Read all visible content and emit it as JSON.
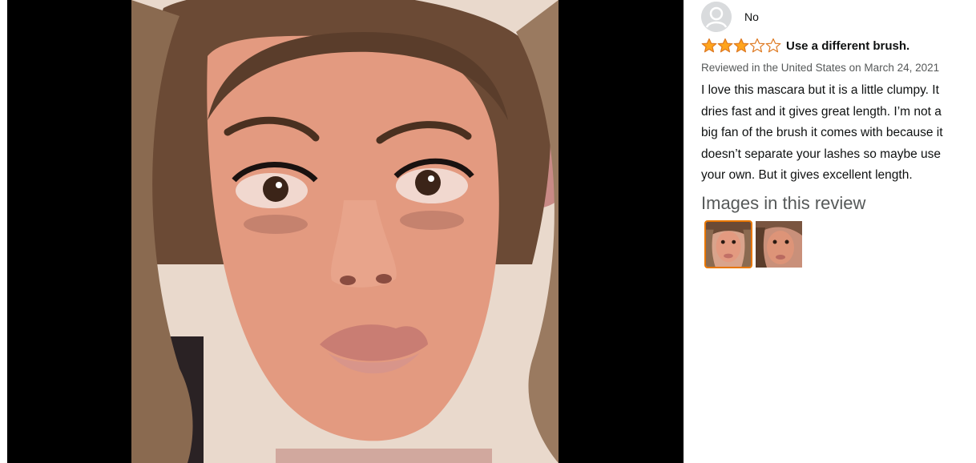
{
  "reviewer": {
    "name": "No",
    "avatar_icon": "user-silhouette-icon"
  },
  "review": {
    "rating": 3,
    "rating_max": 5,
    "title": "Use a different brush.",
    "date_line": "Reviewed in the United States on March 24, 2021",
    "body_lines": [
      "I love this mascara but it is a little clumpy. It",
      "dries fast and it gives great length. I’m not a",
      "big fan of the brush it comes with because it",
      "doesn’t separate your lashes so maybe use",
      "your own. But it gives excellent length."
    ]
  },
  "images_section": {
    "heading": "Images in this review",
    "selected_index": 0,
    "thumbnail_count": 2
  },
  "colors": {
    "star_fill": "#ffa41c",
    "star_stroke": "#de7921",
    "selected_border": "#e77600",
    "viewer_bg": "#000000"
  }
}
